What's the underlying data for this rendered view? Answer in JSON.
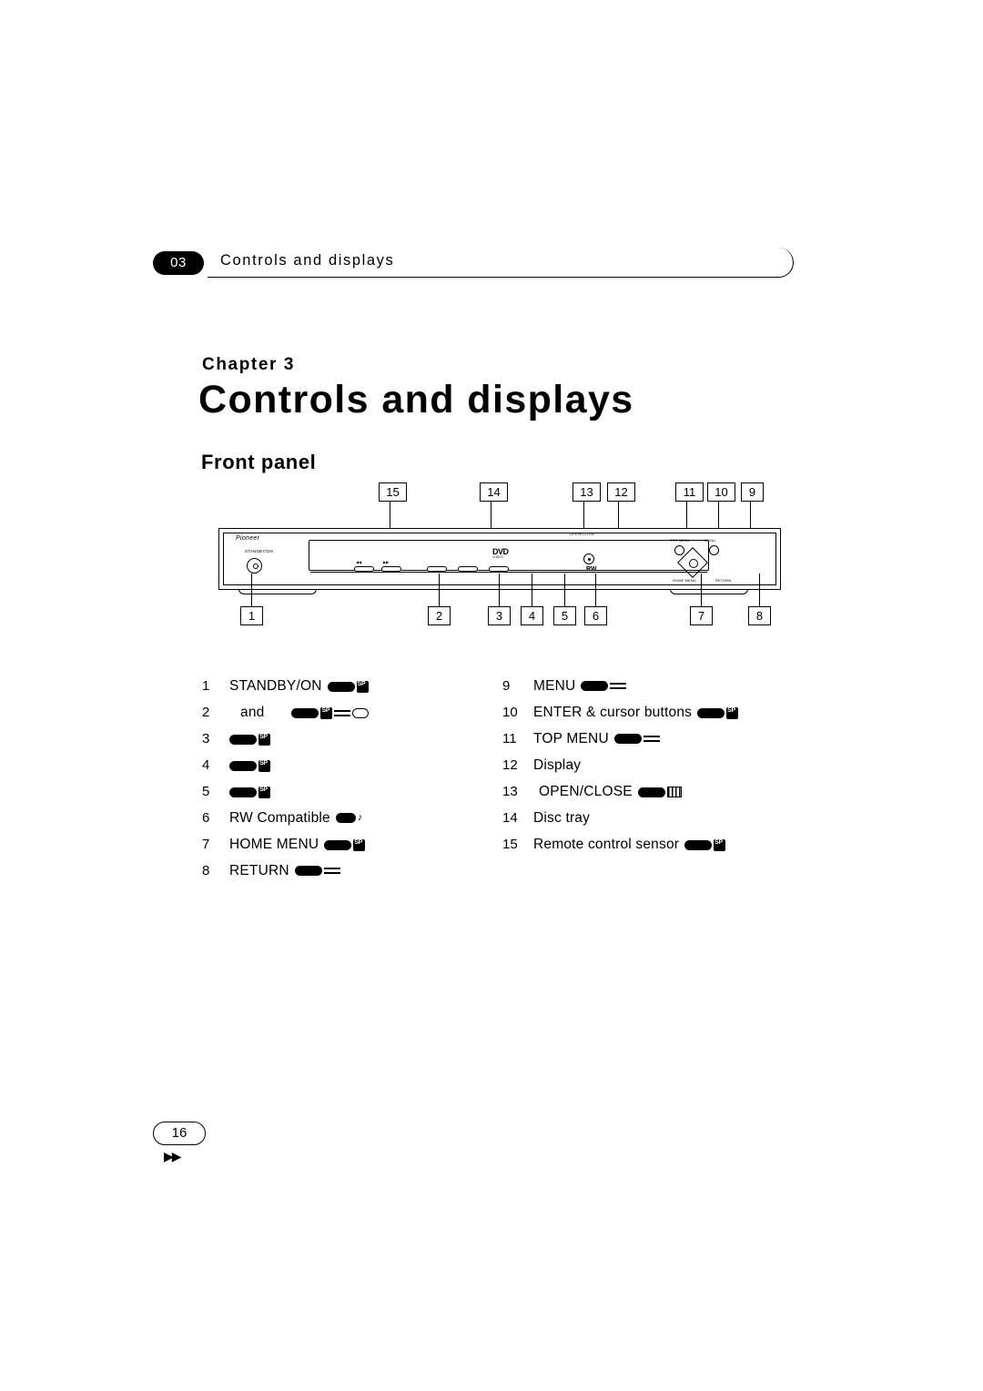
{
  "header": {
    "chapter_number": "03",
    "running_title": "Controls and displays"
  },
  "chapter": {
    "label": "Chapter 3",
    "title": "Controls and displays"
  },
  "section": {
    "title": "Front panel"
  },
  "diagram": {
    "callouts": [
      "15",
      "14",
      "13",
      "12",
      "11",
      "10",
      "9",
      "1",
      "2",
      "3",
      "4",
      "5",
      "6",
      "7",
      "8"
    ],
    "device_labels": {
      "brand": "Pioneer",
      "standby": "STANDBY/ON",
      "dvd_logo": "DVD",
      "dvd_sub": "VIDEO",
      "open_close": "OPEN/CLOSE",
      "rw": "RW",
      "top_menu": "TOP MENU",
      "menu": "MENU",
      "home_menu": "HOME MENU",
      "return": "RETURN",
      "prev": "◀◀",
      "next": "▶▶"
    }
  },
  "legend": {
    "left": [
      {
        "num": "1",
        "text": "STANDBY/ON",
        "icons": [
          "blob",
          "sp"
        ]
      },
      {
        "num": "2",
        "text": "and",
        "icons": [
          "blob",
          "sp",
          "lines",
          "disc"
        ]
      },
      {
        "num": "3",
        "text": "",
        "icons": [
          "blob",
          "sp"
        ]
      },
      {
        "num": "4",
        "text": "",
        "icons": [
          "blob",
          "sp"
        ]
      },
      {
        "num": "5",
        "text": "",
        "icons": [
          "blob",
          "sp"
        ]
      },
      {
        "num": "6",
        "text": "RW Compatible",
        "icons": [
          "blob",
          "note"
        ]
      },
      {
        "num": "7",
        "text": "HOME MENU",
        "icons": [
          "blob",
          "sp"
        ]
      },
      {
        "num": "8",
        "text": "RETURN",
        "icons": [
          "blob",
          "lines"
        ]
      }
    ],
    "right": [
      {
        "num": "9",
        "text": "MENU",
        "icons": [
          "blob",
          "lines"
        ]
      },
      {
        "num": "10",
        "text": "ENTER & cursor buttons",
        "icons": [
          "blob",
          "sp"
        ]
      },
      {
        "num": "11",
        "text": "TOP MENU",
        "icons": [
          "blob",
          "lines"
        ]
      },
      {
        "num": "12",
        "text": "Display",
        "icons": []
      },
      {
        "num": "13",
        "text": "OPEN/CLOSE",
        "icons": [
          "blob",
          "grid"
        ]
      },
      {
        "num": "14",
        "text": "Disc tray",
        "icons": []
      },
      {
        "num": "15",
        "text": "Remote control sensor",
        "icons": [
          "blob",
          "sp"
        ]
      }
    ]
  },
  "footer": {
    "page_number": "16",
    "arrows": "▶▶"
  }
}
